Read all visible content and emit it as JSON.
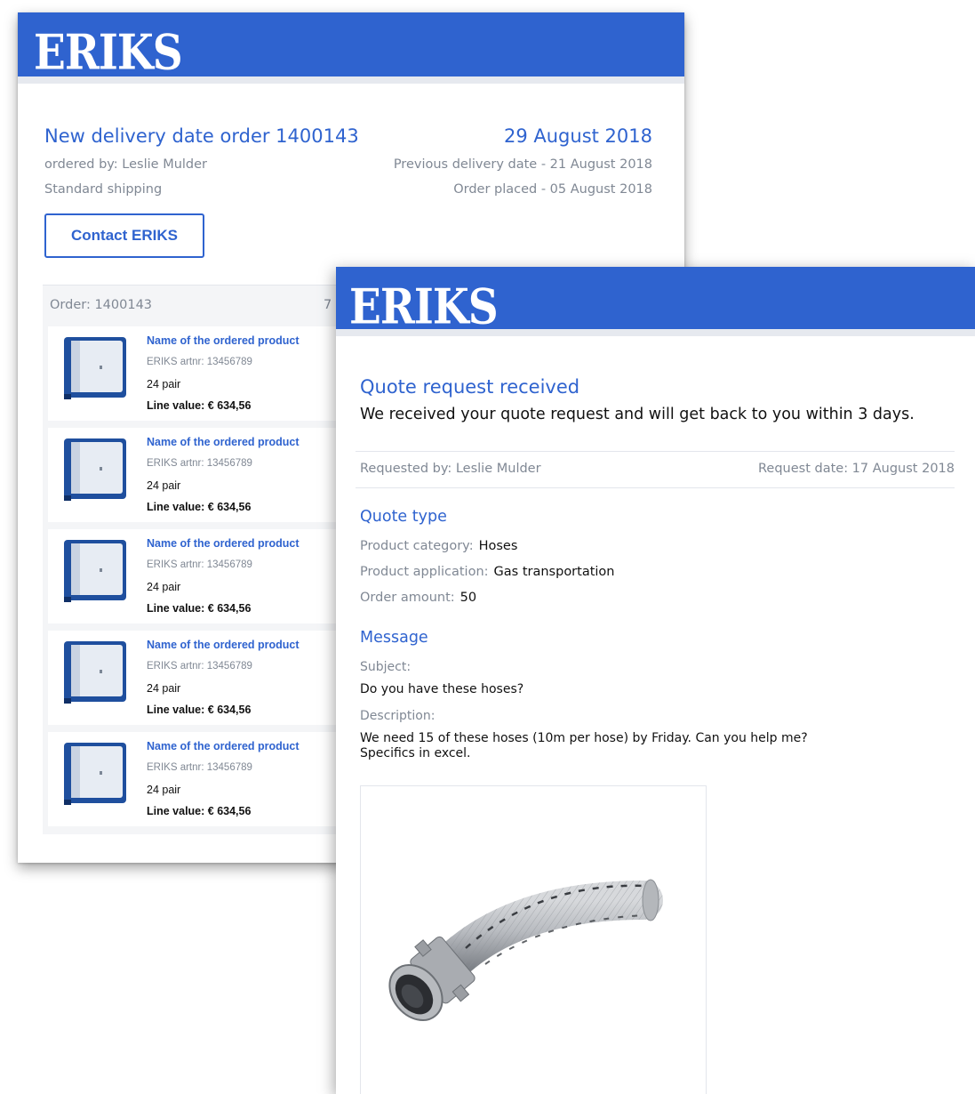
{
  "delivery_email": {
    "logo": "ERIKS",
    "title": "New delivery date order 1400143",
    "new_date": "29 August 2018",
    "ordered_by": "ordered by: Leslie Mulder",
    "shipping": "Standard shipping",
    "previous_date": "Previous delivery date - 21 August 2018",
    "order_placed": "Order placed - 05 August 2018",
    "contact_button": "Contact ERIKS",
    "order_label": "Order: 1400143",
    "order_right_partial": "7",
    "products": [
      {
        "name": "Name of the ordered product",
        "artnr": "ERIKS artnr: 13456789",
        "qty": "24 pair",
        "line_value": "Line value: € 634,56"
      },
      {
        "name": "Name of the ordered product",
        "artnr": "ERIKS artnr: 13456789",
        "qty": "24 pair",
        "line_value": "Line value: € 634,56"
      },
      {
        "name": "Name of the ordered product",
        "artnr": "ERIKS artnr: 13456789",
        "qty": "24 pair",
        "line_value": "Line value: € 634,56"
      },
      {
        "name": "Name of the ordered product",
        "artnr": "ERIKS artnr: 13456789",
        "qty": "24 pair",
        "line_value": "Line value: € 634,56"
      },
      {
        "name": "Name of the ordered product",
        "artnr": "ERIKS artnr: 13456789",
        "qty": "24 pair",
        "line_value": "Line value: € 634,56"
      }
    ]
  },
  "quote_email": {
    "logo": "ERIKS",
    "title": "Quote request received",
    "intro": "We received your quote request and will get back to you within 3 days.",
    "requested_by": "Requested by: Leslie Mulder",
    "request_date": "Request date: 17 August 2018",
    "quote_type_heading": "Quote type",
    "product_category_label": "Product category:",
    "product_category_value": "Hoses",
    "product_application_label": "Product application:",
    "product_application_value": "Gas transportation",
    "order_amount_label": "Order amount:",
    "order_amount_value": "50",
    "message_heading": "Message",
    "subject_label": "Subject:",
    "subject_value": "Do you have these hoses?",
    "description_label": "Description:",
    "description_line1": "We need 15 of these hoses (10m per hose) by Friday. Can you help me?",
    "description_line2": "Specifics in excel."
  },
  "colors": {
    "brand_blue": "#2f63cf",
    "muted_grey": "#808894",
    "panel_grey": "#f4f5f7"
  }
}
